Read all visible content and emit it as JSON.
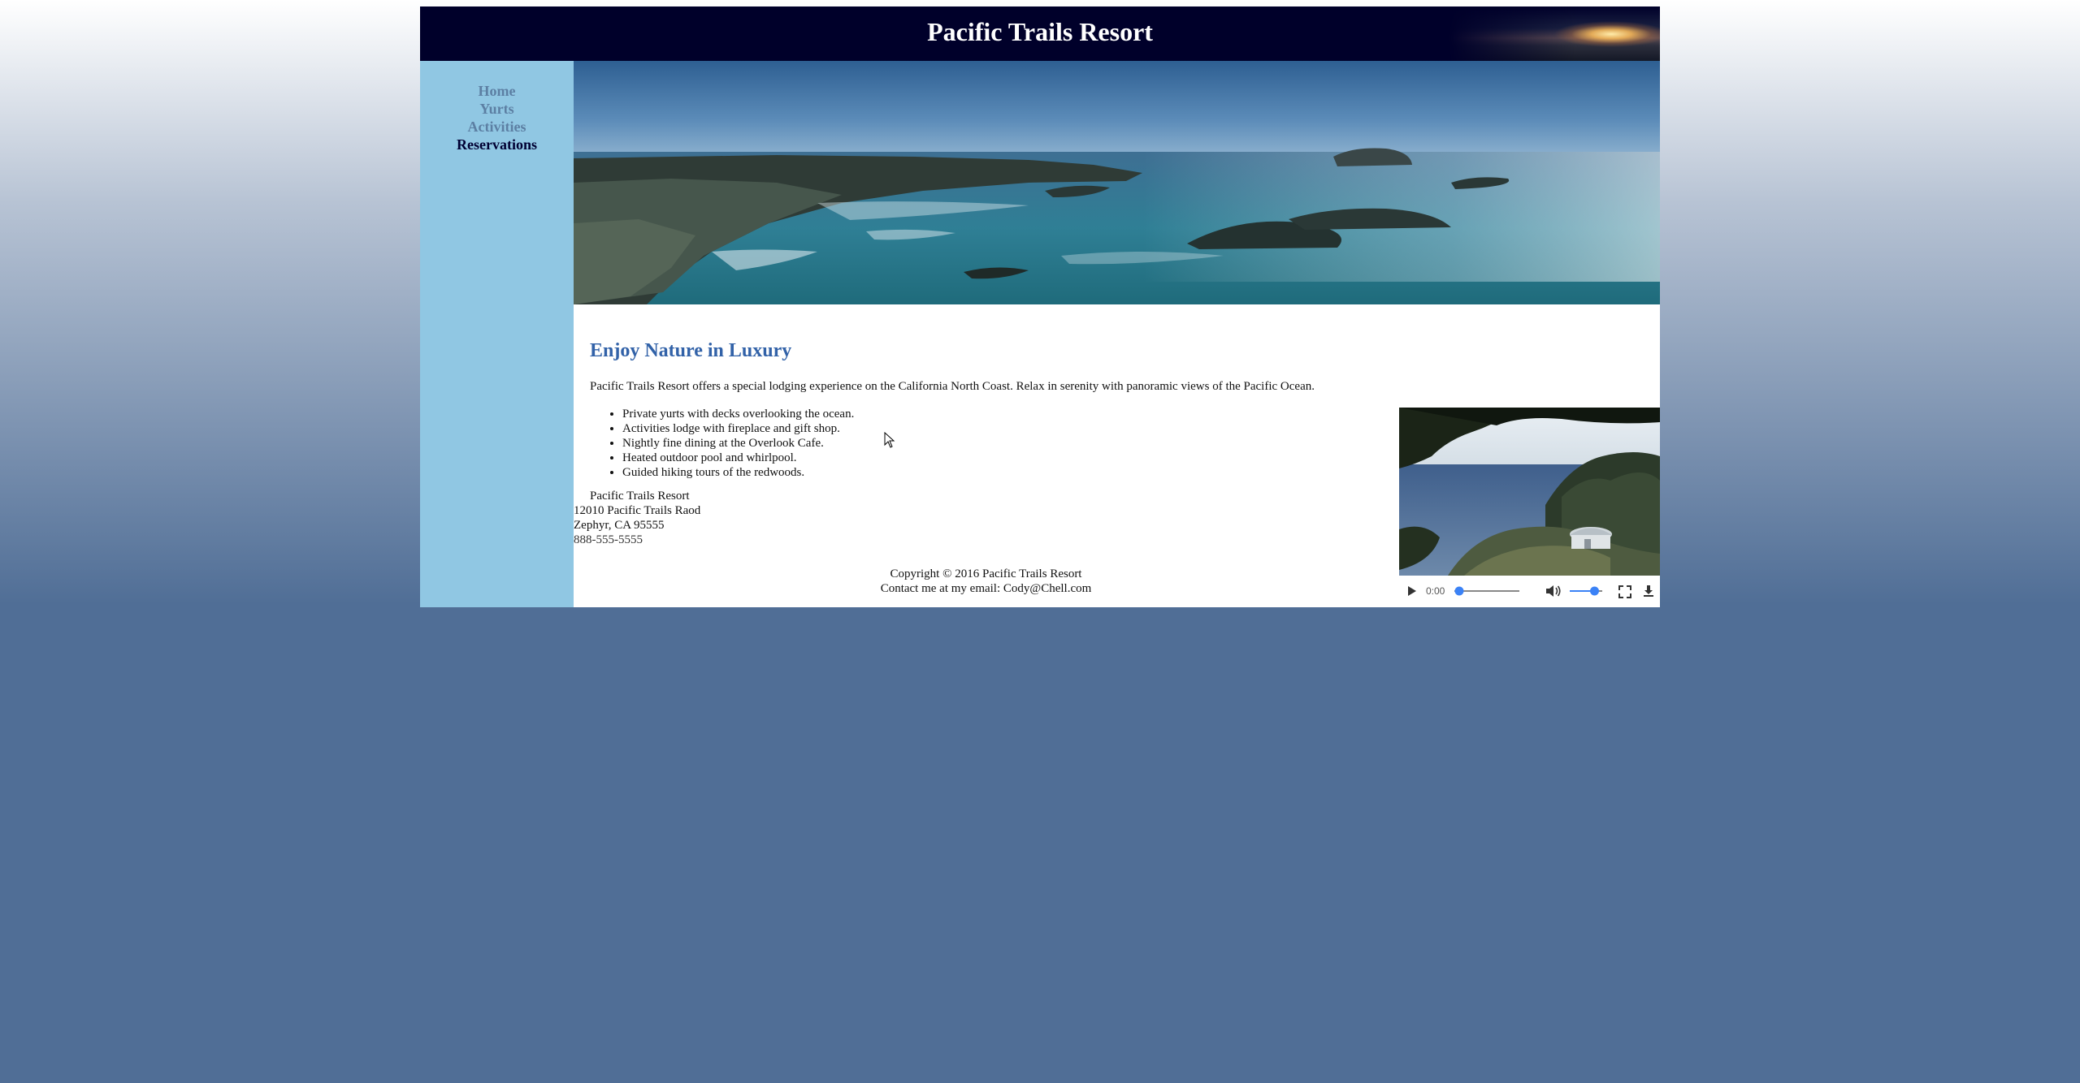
{
  "header": {
    "title": "Pacific Trails Resort"
  },
  "nav": {
    "items": [
      {
        "label": "Home"
      },
      {
        "label": "Yurts"
      },
      {
        "label": "Activities"
      },
      {
        "label": "Reservations"
      }
    ]
  },
  "main": {
    "heading": "Enjoy Nature in Luxury",
    "intro": "Pacific Trails Resort offers a special lodging experience on the California North Coast. Relax in serenity with panoramic views of the Pacific Ocean.",
    "features": [
      "Private yurts with decks overlooking the ocean.",
      "Activities lodge with fireplace and gift shop.",
      "Nightly fine dining at the Overlook Cafe.",
      "Heated outdoor pool and whirlpool.",
      "Guided hiking tours of the redwoods."
    ]
  },
  "address": {
    "name": "Pacific Trails Resort",
    "street": "12010 Pacific Trails Raod",
    "city": "Zephyr, CA 95555",
    "phone": "888-555-5555"
  },
  "footer": {
    "copyright": "Copyright © 2016 Pacific Trails Resort",
    "contact": "Contact me at my email: Cody@Chell.com"
  },
  "video": {
    "time": "0:00",
    "progress": 0,
    "volume": 0.85
  },
  "colors": {
    "header_bg": "#00002a",
    "nav_bg": "#90c7e3",
    "nav_link": "#5c7fa3",
    "nav_current": "#000033",
    "heading": "#3262a8",
    "page_bottom": "#506e96",
    "accent_blue": "#3b82f6"
  },
  "icons": [
    "play-icon",
    "volume-icon",
    "fullscreen-icon",
    "download-icon",
    "cursor-icon"
  ]
}
